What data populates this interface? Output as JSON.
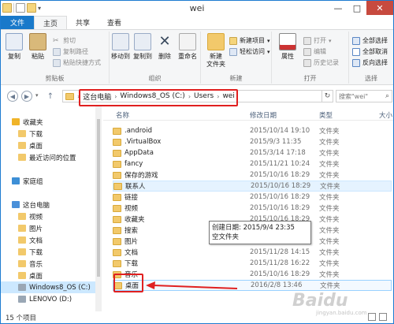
{
  "window": {
    "title": "wei",
    "minimize": "—",
    "maximize": "□",
    "close": "✕"
  },
  "ribbon_tabs": [
    "文件",
    "主页",
    "共享",
    "查看"
  ],
  "ribbon": {
    "clipboard": {
      "label": "剪贴板",
      "copy": "复制",
      "paste": "粘贴",
      "cut": "剪切",
      "copy_path": "复制路径",
      "paste_shortcut": "粘贴快捷方式"
    },
    "organize": {
      "label": "组织",
      "move_to": "移动到",
      "copy_to": "复制到",
      "delete": "删除",
      "rename": "重命名"
    },
    "new": {
      "label": "新建",
      "new_folder": "新建\n文件夹",
      "new_item": "新建项目",
      "easy_access": "轻松访问"
    },
    "open": {
      "label": "打开",
      "properties": "属性",
      "open": "打开",
      "edit": "编辑",
      "history": "历史记录"
    },
    "select": {
      "label": "选择",
      "select_all": "全部选择",
      "select_none": "全部取消",
      "invert": "反向选择"
    }
  },
  "address": {
    "crumbs": [
      "这台电脑",
      "Windows8_OS (C:)",
      "Users",
      "wei"
    ],
    "search_placeholder": "搜索\"wei\""
  },
  "nav": [
    {
      "label": "收藏夹",
      "kind": "star"
    },
    {
      "label": "下载",
      "kind": "folder"
    },
    {
      "label": "桌面",
      "kind": "folder"
    },
    {
      "label": "最近访问的位置",
      "kind": "folder"
    },
    {
      "label": "家庭组",
      "kind": "home"
    },
    {
      "label": "这台电脑",
      "kind": "pc"
    },
    {
      "label": "视频",
      "kind": "folder"
    },
    {
      "label": "图片",
      "kind": "folder"
    },
    {
      "label": "文档",
      "kind": "folder"
    },
    {
      "label": "下载",
      "kind": "folder"
    },
    {
      "label": "音乐",
      "kind": "folder"
    },
    {
      "label": "桌面",
      "kind": "folder"
    },
    {
      "label": "Windows8_OS (C:)",
      "kind": "drive"
    },
    {
      "label": "LENOVO (D:)",
      "kind": "drive"
    }
  ],
  "columns": {
    "name": "名称",
    "date": "修改日期",
    "type": "类型",
    "size": "大小"
  },
  "files": [
    {
      "name": ".android",
      "date": "2015/10/14 19:10",
      "type": "文件夹"
    },
    {
      "name": ".VirtualBox",
      "date": "2015/9/3 11:35",
      "type": "文件夹"
    },
    {
      "name": "AppData",
      "date": "2015/3/14 17:18",
      "type": "文件夹"
    },
    {
      "name": "fancy",
      "date": "2015/11/21 10:24",
      "type": "文件夹"
    },
    {
      "name": "保存的游戏",
      "date": "2015/10/16 18:29",
      "type": "文件夹"
    },
    {
      "name": "联系人",
      "date": "2015/10/16 18:29",
      "type": "文件夹"
    },
    {
      "name": "链接",
      "date": "2015/10/16 18:29",
      "type": "文件夹"
    },
    {
      "name": "视频",
      "date": "2015/10/16 18:29",
      "type": "文件夹"
    },
    {
      "name": "收藏夹",
      "date": "2015/10/16 18:29",
      "type": "文件夹"
    },
    {
      "name": "搜索",
      "date": "2015/10/16 18:29",
      "type": "文件夹"
    },
    {
      "name": "图片",
      "date": "2015/10/16 18:29",
      "type": "文件夹"
    },
    {
      "name": "文档",
      "date": "2015/11/28 14:15",
      "type": "文件夹"
    },
    {
      "name": "下载",
      "date": "2015/11/28 16:22",
      "type": "文件夹"
    },
    {
      "name": "音乐",
      "date": "2015/10/16 18:29",
      "type": "文件夹"
    },
    {
      "name": "桌面",
      "date": "2016/2/8 13:46",
      "type": "文件夹"
    }
  ],
  "tooltip": {
    "line1": "创建日期: 2015/9/4 23:35",
    "line2": "空文件夹"
  },
  "status": {
    "count": "15 个项目"
  },
  "watermark": {
    "main": "Baidu",
    "sub": "jingyan.baidu.com"
  },
  "colors": {
    "accent": "#1979ca",
    "highlight": "#e02020"
  }
}
